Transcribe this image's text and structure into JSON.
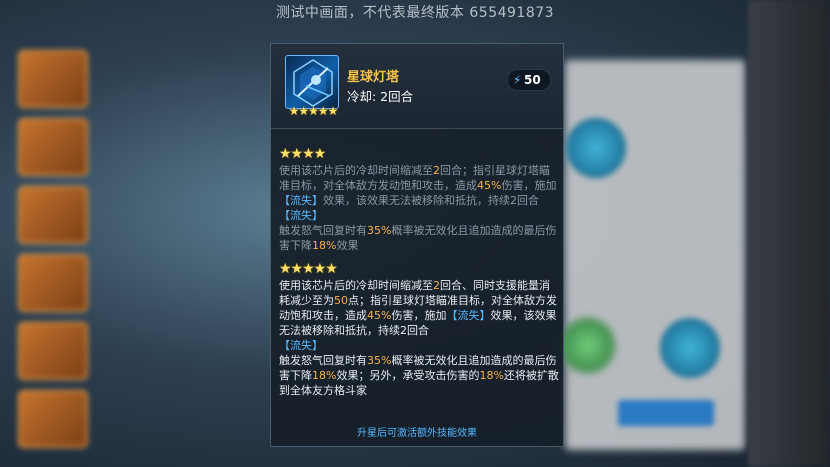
{
  "watermark": "测试中画面，不代表最终版本 655491873",
  "skill": {
    "name": "星球灯塔",
    "cooldown": "冷却: 2回合",
    "energy": "50",
    "icon": "lighthouse-icon",
    "stars": "★★★★★"
  },
  "tier4": {
    "stars": "★★★★",
    "desc": [
      {
        "t": "使用该芯片后的冷却时间缩减至",
        "c": "gray"
      },
      {
        "t": "2",
        "c": "hl"
      },
      {
        "t": "回合；指引星球灯塔瞄准目标，对全体敌方发动饱和攻击，造成",
        "c": "gray"
      },
      {
        "t": "45%",
        "c": "hl"
      },
      {
        "t": "伤害，施加",
        "c": "gray"
      },
      {
        "t": "【流失】",
        "c": "blue"
      },
      {
        "t": "效果，该效果无法被移除和抵抗，持续2回合",
        "c": "gray"
      }
    ],
    "effect_title": "【流失】",
    "effect": [
      {
        "t": "触发怒气回复时有",
        "c": "gray"
      },
      {
        "t": "35%",
        "c": "hl"
      },
      {
        "t": "概率被无效化且追加造成的最后伤害下降",
        "c": "gray"
      },
      {
        "t": "18%",
        "c": "hl"
      },
      {
        "t": "效果",
        "c": "gray"
      }
    ]
  },
  "tier5": {
    "stars": "★★★★★",
    "desc": [
      {
        "t": "使用该芯片后的冷却时间缩减至",
        "c": "white"
      },
      {
        "t": "2",
        "c": "hl"
      },
      {
        "t": "回合、同时支援能量消耗减少至为",
        "c": "white"
      },
      {
        "t": "50",
        "c": "hl"
      },
      {
        "t": "点；指引星球灯塔瞄准目标，对全体敌方发动饱和攻击，造成",
        "c": "white"
      },
      {
        "t": "45%",
        "c": "hl"
      },
      {
        "t": "伤害，施加",
        "c": "white"
      },
      {
        "t": "【流失】",
        "c": "blue"
      },
      {
        "t": "效果，该效果无法被移除和抵抗，持续2回合",
        "c": "white"
      }
    ],
    "effect_title": "【流失】",
    "effect": [
      {
        "t": "触发怒气回复时有",
        "c": "white"
      },
      {
        "t": "35%",
        "c": "hl"
      },
      {
        "t": "概率被无效化且追加造成的最后伤害下降",
        "c": "white"
      },
      {
        "t": "18%",
        "c": "hl"
      },
      {
        "t": "效果；另外，承受攻击伤害的",
        "c": "white"
      },
      {
        "t": "18%",
        "c": "hl"
      },
      {
        "t": "还将被扩散到全体友方格斗家",
        "c": "white"
      }
    ]
  },
  "footer": "升星后可激活额外技能效果"
}
